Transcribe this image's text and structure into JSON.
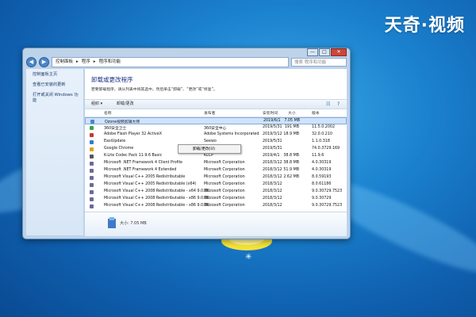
{
  "brand": "天奇·视频",
  "window": {
    "caption": {
      "minimize": "—",
      "maximize": "□",
      "close": "✕"
    },
    "address": [
      "控制面板",
      "程序",
      "程序和功能"
    ],
    "search_placeholder": "搜索 程序和功能"
  },
  "sidebar": {
    "items": [
      "控制面板主页",
      "查看已安装的更新",
      "打开或关闭 Windows 功能"
    ]
  },
  "content": {
    "heading": "卸载或更改程序",
    "description": "若要卸载程序，请从列表中将其选中，然后单击“卸载”、“更改”或“修复”。",
    "toolbar": {
      "organize": "组织 ▾",
      "uninstall_change": "卸载/更改"
    },
    "columns": [
      "名称",
      "发布者",
      "安装时间",
      "大小",
      "版本"
    ],
    "rows": [
      {
        "name": "Ozone视频剪辑大师",
        "publisher": "",
        "date": "2019/6/1",
        "size": "7.05 MB",
        "version": "",
        "color": "#4a86c7",
        "selected": true
      },
      {
        "name": "360安全卫士",
        "publisher": "360安全中心",
        "date": "2019/5/31",
        "size": "191 MB",
        "version": "11.5.0.2002",
        "color": "#3aa34a"
      },
      {
        "name": "Adobe Flash Player 32 ActiveX",
        "publisher": "Adobe Systems Incorporated",
        "date": "2019/3/12",
        "size": "18.9 MB",
        "version": "32.0.0.210",
        "color": "#c23b2e"
      },
      {
        "name": "EasiUpdate",
        "publisher": "Seewo",
        "date": "2019/5/31",
        "size": "",
        "version": "1.1.0.318",
        "color": "#2e7dd1"
      },
      {
        "name": "Google Chrome",
        "publisher": "Google Inc.",
        "date": "2019/5/31",
        "size": "",
        "version": "74.0.3729.169",
        "color": "#e0a21a"
      },
      {
        "name": "K-Lite Codec Pack 11.9.6 Basic",
        "publisher": "KLCP",
        "date": "2019/4/1",
        "size": "38.8 MB",
        "version": "11.9.6",
        "color": "#555555"
      },
      {
        "name": "Microsoft .NET Framework 4 Client Profile",
        "publisher": "Microsoft Corporation",
        "date": "2018/3/12",
        "size": "38.8 MB",
        "version": "4.0.30319",
        "color": "#6a6a9a"
      },
      {
        "name": "Microsoft .NET Framework 4 Extended",
        "publisher": "Microsoft Corporation",
        "date": "2018/3/12",
        "size": "51.9 MB",
        "version": "4.0.30319",
        "color": "#6a6a9a"
      },
      {
        "name": "Microsoft Visual C++ 2005 Redistributable",
        "publisher": "Microsoft Corporation",
        "date": "2018/3/12",
        "size": "2.62 MB",
        "version": "8.0.59193",
        "color": "#6a6a9a"
      },
      {
        "name": "Microsoft Visual C++ 2005 Redistributable (x64)",
        "publisher": "Microsoft Corporation",
        "date": "2018/3/12",
        "size": "",
        "version": "8.0.61186",
        "color": "#6a6a9a"
      },
      {
        "name": "Microsoft Visual C++ 2008 Redistributable - x64 9.0.30...",
        "publisher": "Microsoft Corporation",
        "date": "2018/3/12",
        "size": "",
        "version": "9.0.30729.7523",
        "color": "#6a6a9a"
      },
      {
        "name": "Microsoft Visual C++ 2008 Redistributable - x86 9.0.30...",
        "publisher": "Microsoft Corporation",
        "date": "2018/3/12",
        "size": "",
        "version": "9.0.30729",
        "color": "#6a6a9a"
      },
      {
        "name": "Microsoft Visual C++ 2008 Redistributable - x86 9.0.30...",
        "publisher": "Microsoft Corporation",
        "date": "2018/3/12",
        "size": "",
        "version": "9.0.30729.7523",
        "color": "#6a6a9a"
      }
    ],
    "context_menu": {
      "item": "卸载/更改(U)"
    },
    "details": {
      "size_text": "大小: 7.05 MB"
    }
  }
}
